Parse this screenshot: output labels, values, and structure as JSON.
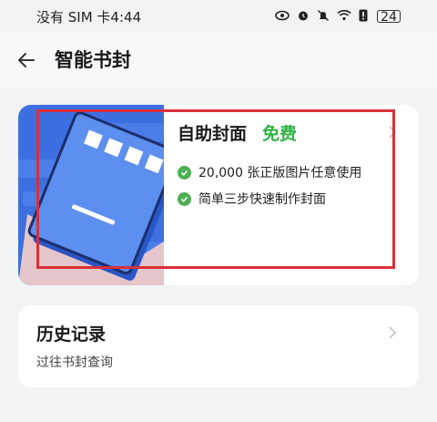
{
  "status_bar": {
    "carrier_time": "没有 SIM 卡4:44",
    "battery": "24"
  },
  "header": {
    "title": "智能书封"
  },
  "cover_card": {
    "title": "自助封面",
    "tag": "免费",
    "features": [
      "20,000 张正版图片任意使用",
      "简单三步快速制作封面"
    ]
  },
  "history_card": {
    "title": "历史记录",
    "subtitle": "过往书封查询"
  },
  "colors": {
    "accent_green": "#2fb344",
    "check_green": "#4caf50",
    "highlight_red": "#d9303a",
    "illustration_blue": "#3d6fe0"
  }
}
